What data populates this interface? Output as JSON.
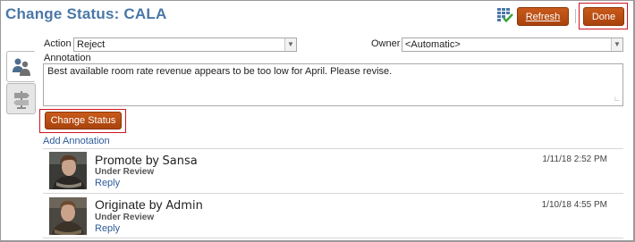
{
  "header": {
    "title": "Change Status: CALA",
    "refresh_label": "Refresh",
    "done_label": "Done",
    "grid_icon": "grid-check-icon"
  },
  "side_tabs": [
    {
      "icon": "people-icon",
      "active": true
    },
    {
      "icon": "signpost-icon",
      "active": false
    }
  ],
  "form": {
    "action_label": "Action",
    "action_value": "Reject",
    "owner_label": "Owner",
    "owner_value": "<Automatic>",
    "annotation_label": "Annotation",
    "annotation_text": "Best available room rate revenue appears to be too low for April. Please revise.",
    "change_status_label": "Change Status",
    "add_annotation_label": "Add Annotation"
  },
  "history": [
    {
      "action": "Promote",
      "by": "by",
      "user": "Sansa",
      "status": "Under Review",
      "reply": "Reply",
      "date": "1/11/18 2:52 PM"
    },
    {
      "action": "Originate",
      "by": "by",
      "user": "Admin",
      "status": "Under Review",
      "reply": "Reply",
      "date": "1/10/18 4:55 PM"
    }
  ],
  "colors": {
    "title": "#4a77a8",
    "button": "#b84e12",
    "link": "#2d5c99",
    "highlight": "#d0151d"
  }
}
